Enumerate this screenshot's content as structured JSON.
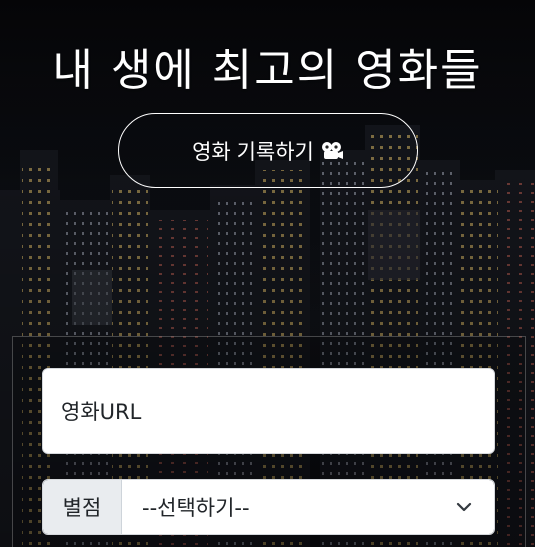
{
  "header": {
    "title": "내 생에 최고의 영화들"
  },
  "record_button": {
    "label": "영화 기록하기",
    "icon": "film-projector-icon"
  },
  "form": {
    "url_input": {
      "value": "",
      "placeholder": "영화URL"
    },
    "rating_select": {
      "addon_label": "별점",
      "selected": "--선택하기--",
      "icon": "chevron-down-icon"
    }
  },
  "colors": {
    "background": "#0b0c10",
    "text": "#ffffff",
    "input_bg": "#ffffff",
    "addon_bg": "#e9ecef"
  }
}
